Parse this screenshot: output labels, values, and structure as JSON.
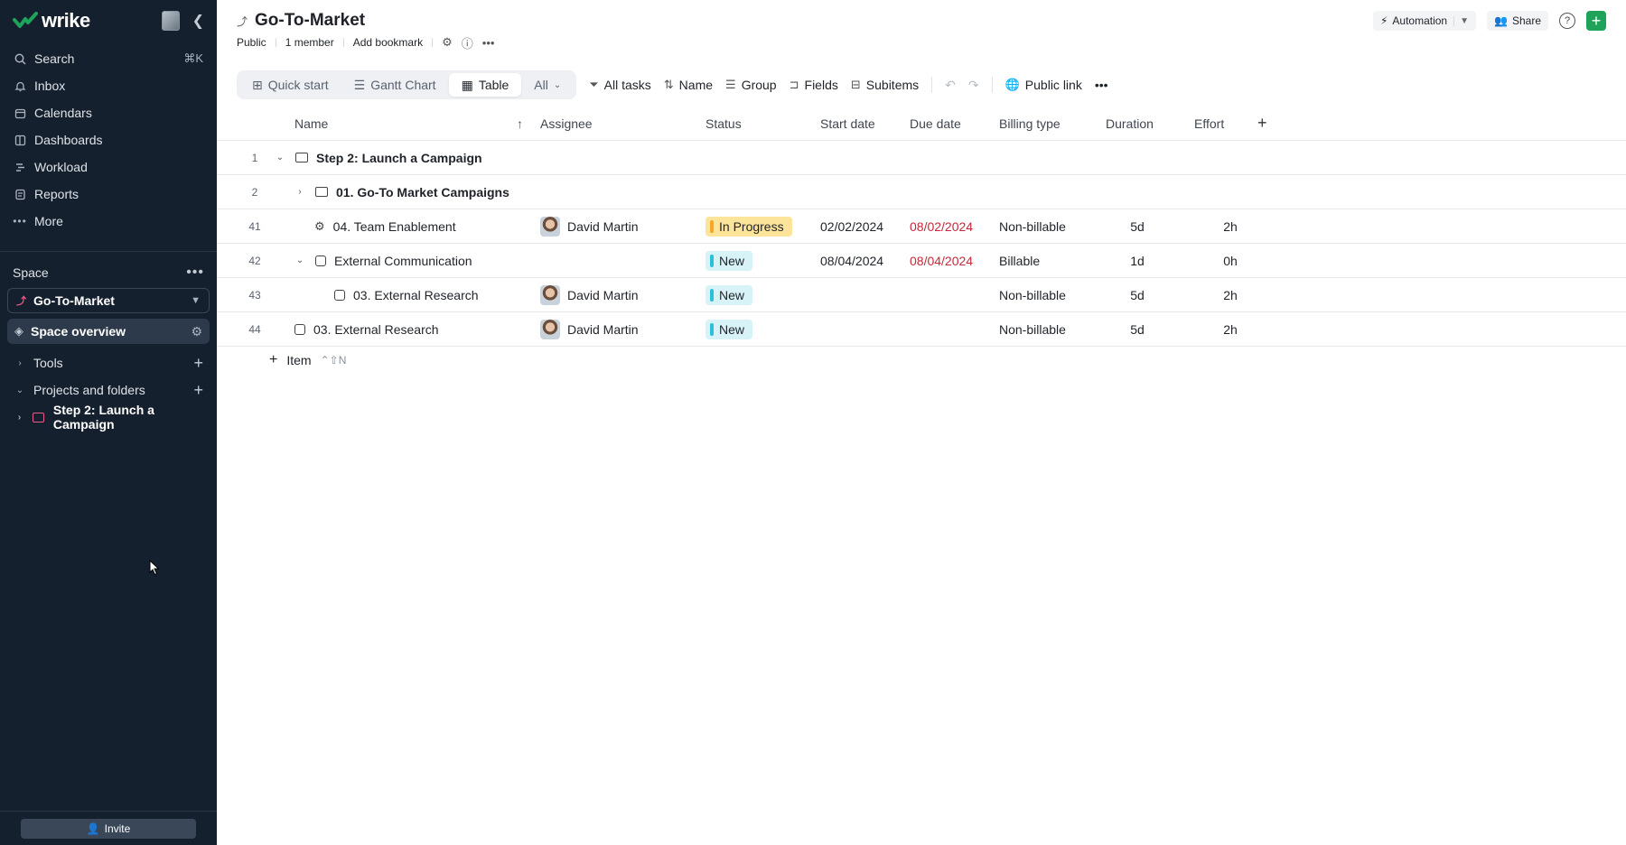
{
  "brand": {
    "name": "wrike",
    "accent": "#1ea35a"
  },
  "sidebar": {
    "nav": [
      {
        "label": "Search",
        "icon": "search-icon",
        "shortcut": "⌘K"
      },
      {
        "label": "Inbox",
        "icon": "bell-icon"
      },
      {
        "label": "Calendars",
        "icon": "calendar-icon"
      },
      {
        "label": "Dashboards",
        "icon": "dashboard-icon"
      },
      {
        "label": "Workload",
        "icon": "workload-icon"
      },
      {
        "label": "Reports",
        "icon": "reports-icon"
      },
      {
        "label": "More",
        "icon": "more-icon"
      }
    ],
    "space_heading": "Space",
    "space_name": "Go-To-Market",
    "space_overview": "Space overview",
    "tools_label": "Tools",
    "projects_label": "Projects and folders",
    "project_item": "Step 2: Launch a Campaign",
    "invite_label": "Invite"
  },
  "header": {
    "title": "Go-To-Market",
    "automation_label": "Automation",
    "share_label": "Share",
    "visibility": "Public",
    "members": "1 member",
    "bookmark": "Add bookmark"
  },
  "toolbar": {
    "tabs": [
      {
        "label": "Quick start"
      },
      {
        "label": "Gantt Chart"
      },
      {
        "label": "Table"
      }
    ],
    "scope_label": "All",
    "filter_label": "All tasks",
    "sort_label": "Name",
    "group_label": "Group",
    "fields_label": "Fields",
    "subitems_label": "Subitems",
    "public_link_label": "Public link"
  },
  "table": {
    "columns": {
      "name": "Name",
      "assignee": "Assignee",
      "status": "Status",
      "start": "Start date",
      "due": "Due date",
      "billing": "Billing type",
      "duration": "Duration",
      "effort": "Effort"
    },
    "rows": [
      {
        "num": "1",
        "name": "Step 2: Launch a Campaign"
      },
      {
        "num": "2",
        "name": "01. Go-To Market Campaigns"
      },
      {
        "num": "41",
        "name": "04. Team Enablement",
        "assignee": "David Martin",
        "status": "In Progress",
        "start": "02/02/2024",
        "due": "08/02/2024",
        "billing": "Non-billable",
        "duration": "5d",
        "effort": "2h"
      },
      {
        "num": "42",
        "name": "External Communication",
        "status": "New",
        "start": "08/04/2024",
        "due": "08/04/2024",
        "billing": "Billable",
        "duration": "1d",
        "effort": "0h"
      },
      {
        "num": "43",
        "name": "03. External Research",
        "assignee": "David Martin",
        "status": "New",
        "billing": "Non-billable",
        "duration": "5d",
        "effort": "2h"
      },
      {
        "num": "44",
        "name": "03. External Research",
        "assignee": "David Martin",
        "status": "New",
        "billing": "Non-billable",
        "duration": "5d",
        "effort": "2h"
      }
    ],
    "add_item_label": "Item",
    "add_item_shortcut": "⌃⇧N"
  },
  "colors": {
    "in_progress_bg": "#fde49b",
    "in_progress_bar": "#f4a826",
    "new_bg": "#d7f3f7",
    "new_bar": "#2bc0d9",
    "due_overdue": "#c8283a",
    "sidebar_bg": "#15202e"
  }
}
